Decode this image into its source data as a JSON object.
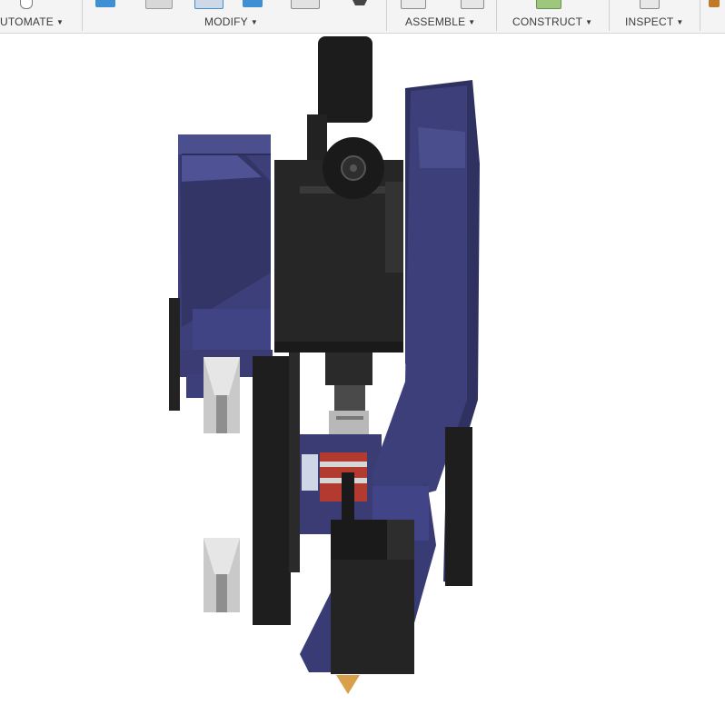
{
  "toolbar": {
    "groups": [
      {
        "label": "UTOMATE",
        "caret": "▼"
      },
      {
        "label": "MODIFY",
        "caret": "▼"
      },
      {
        "label": "ASSEMBLE",
        "caret": "▼"
      },
      {
        "label": "CONSTRUCT",
        "caret": "▼"
      },
      {
        "label": "INSPECT",
        "caret": "▼"
      }
    ]
  },
  "icons": {
    "automate": "automate-icon",
    "modify_1": "press-pull-icon",
    "modify_2": "fillet-icon",
    "modify_3": "chamfer-icon",
    "modify_4": "shell-icon",
    "modify_5": "combine-icon",
    "modify_6": "move-icon",
    "assemble_1": "new-component-icon",
    "assemble_2": "joint-icon",
    "construct_1": "offset-plane-icon",
    "inspect_1": "measure-icon",
    "insert_1": "insert-icon"
  },
  "colors": {
    "toolbar_bg": "#f4f4f4",
    "part_blue": "#3d3f7a",
    "part_black": "#262626",
    "heater_red": "#b23a2e",
    "nozzle_brass": "#d9a04c"
  }
}
